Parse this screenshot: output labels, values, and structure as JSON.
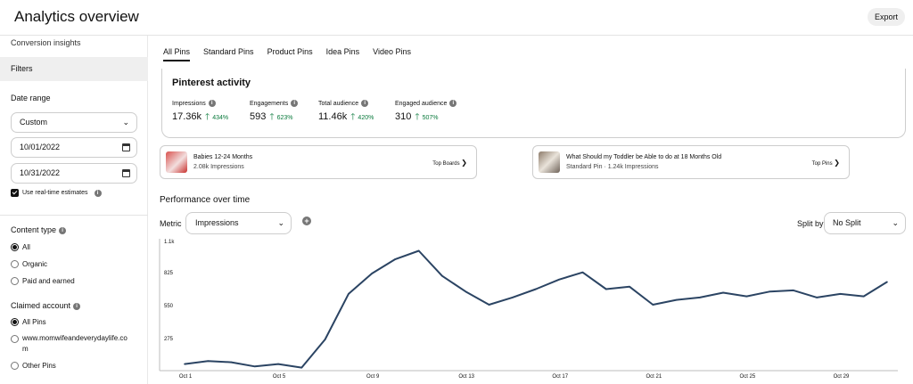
{
  "header": {
    "title": "Analytics overview",
    "export_label": "Export"
  },
  "sidebar": {
    "section_link": "Conversion insights",
    "filters_label": "Filters",
    "date_range": {
      "label": "Date range",
      "preset": "Custom",
      "start": "10/01/2022",
      "end": "10/31/2022",
      "realtime_label": "Use real-time estimates"
    },
    "content_type": {
      "label": "Content type",
      "options": [
        "All",
        "Organic",
        "Paid and earned"
      ],
      "selected": "All"
    },
    "claimed_account": {
      "label": "Claimed account",
      "options": [
        "All Pins",
        "www.momwifeandeverydaylife.com",
        "Other Pins"
      ],
      "selected": "All Pins"
    }
  },
  "tabs": [
    "All Pins",
    "Standard Pins",
    "Product Pins",
    "Idea Pins",
    "Video Pins"
  ],
  "active_tab": "All Pins",
  "activity": {
    "title": "Pinterest activity",
    "metrics": [
      {
        "label": "Impressions",
        "value": "17.36k",
        "change": "434%"
      },
      {
        "label": "Engagements",
        "value": "593",
        "change": "623%"
      },
      {
        "label": "Total audience",
        "value": "11.46k",
        "change": "420%"
      },
      {
        "label": "Engaged audience",
        "value": "310",
        "change": "507%"
      }
    ]
  },
  "top_boards": {
    "title": "Babies 12-24 Months",
    "subtitle": "2.08k Impressions",
    "link": "Top Boards"
  },
  "top_pins": {
    "title": "What Should my Toddler be Able to do at 18 Months Old",
    "subtitle": "Standard Pin · 1.24k Impressions",
    "link": "Top Pins"
  },
  "performance": {
    "title": "Performance over time",
    "metric_label": "Metric",
    "metric_value": "Impressions",
    "split_label": "Split by",
    "split_value": "No Split"
  },
  "colors": {
    "line": "#2b4463",
    "positive": "#0a7a3c"
  },
  "chart_data": {
    "type": "line",
    "x": [
      "Oct 1",
      "Oct 2",
      "Oct 3",
      "Oct 4",
      "Oct 5",
      "Oct 6",
      "Oct 7",
      "Oct 8",
      "Oct 9",
      "Oct 10",
      "Oct 11",
      "Oct 12",
      "Oct 13",
      "Oct 14",
      "Oct 15",
      "Oct 16",
      "Oct 17",
      "Oct 18",
      "Oct 19",
      "Oct 20",
      "Oct 21",
      "Oct 22",
      "Oct 23",
      "Oct 24",
      "Oct 25",
      "Oct 26",
      "Oct 27",
      "Oct 28",
      "Oct 29",
      "Oct 30",
      "Oct 31"
    ],
    "x_tick_labels": [
      "Oct 1",
      "Oct 5",
      "Oct 9",
      "Oct 13",
      "Oct 17",
      "Oct 21",
      "Oct 25",
      "Oct 29"
    ],
    "x_tick_indices": [
      0,
      4,
      8,
      12,
      16,
      20,
      24,
      28
    ],
    "y_ticks": [
      275,
      550,
      825,
      "1.1k"
    ],
    "ylim": [
      0,
      1100
    ],
    "series": [
      {
        "values": [
          55,
          80,
          70,
          35,
          55,
          25,
          260,
          640,
          810,
          930,
          1000,
          790,
          660,
          550,
          610,
          680,
          760,
          820,
          680,
          700,
          550,
          590,
          610,
          650,
          620,
          660,
          670,
          610,
          640,
          620,
          740
        ]
      }
    ]
  }
}
